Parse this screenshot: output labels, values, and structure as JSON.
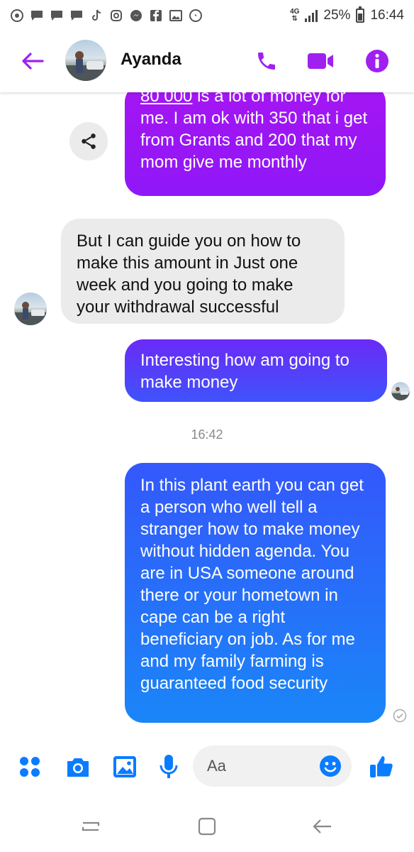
{
  "status_bar": {
    "network": "4G",
    "battery": "25%",
    "time": "16:44",
    "notification_icons": [
      "chrome-icon",
      "messenger-chat-icon",
      "messenger-chat-icon",
      "messenger-chat-icon",
      "tiktok-icon",
      "instagram-icon",
      "messenger-icon",
      "facebook-icon",
      "gallery-icon",
      "messenger-icon"
    ]
  },
  "header": {
    "contact_name": "Ayanda",
    "accent_color": "#a020f0"
  },
  "messages": [
    {
      "type": "outgoing",
      "text_underlined": "80 000",
      "text": " is a lot of money for me. I am ok with 350 that i get from Grants and 200 that my mom give me monthly"
    },
    {
      "type": "incoming",
      "text": "But I can guide you on how to make this amount in Just one week and you going to make your withdrawal successful"
    },
    {
      "type": "outgoing",
      "text": "Interesting how am going to make money"
    },
    {
      "type": "timestamp",
      "text": "16:42"
    },
    {
      "type": "outgoing",
      "text": "In this plant earth you can get a person who well tell a stranger how to make money without hidden agenda. You are in USA someone around there or your hometown in cape can be a right beneficiary on job. As for me and my family farming is guaranteed food security"
    }
  ],
  "composer": {
    "placeholder": "Aa",
    "accent_color": "#0a7cff"
  }
}
